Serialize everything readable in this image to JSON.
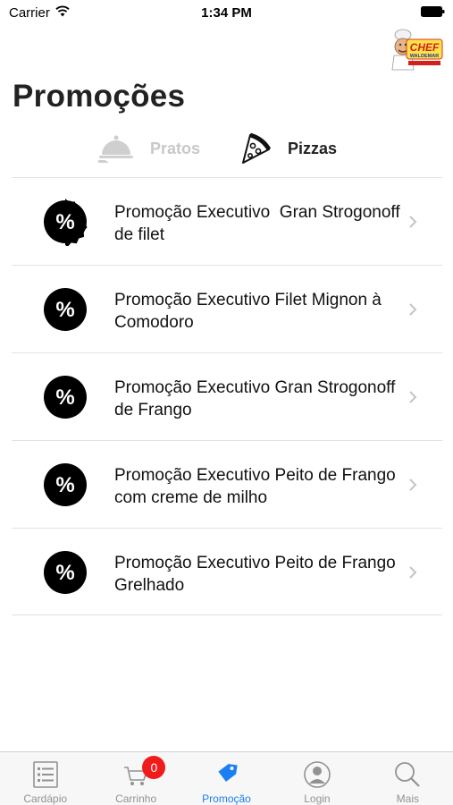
{
  "status_bar": {
    "carrier": "Carrier",
    "time": "1:34 PM"
  },
  "logo": {
    "text_top": "CHEF",
    "text_bottom": "WALDEMAR"
  },
  "page": {
    "title": "Promoções"
  },
  "tabs": [
    {
      "label": "Pratos",
      "icon": "cloche-icon",
      "active": false
    },
    {
      "label": "Pizzas",
      "icon": "pizza-slice-icon",
      "active": true
    }
  ],
  "promotions": [
    {
      "name": "Promoção Executivo  Gran Strogonoff de filet"
    },
    {
      "name": "Promoção Executivo Filet Mignon à Comodoro"
    },
    {
      "name": "Promoção Executivo Gran Strogonoff de Frango"
    },
    {
      "name": "Promoção Executivo Peito de Frango com creme de milho"
    },
    {
      "name": "Promoção Executivo Peito de Frango Grelhado"
    }
  ],
  "tab_bar": {
    "items": [
      {
        "label": "Cardápio",
        "icon": "menu-list-icon"
      },
      {
        "label": "Carrinho",
        "icon": "cart-icon",
        "badge": "0"
      },
      {
        "label": "Promoção",
        "icon": "tag-icon",
        "active": true
      },
      {
        "label": "Login",
        "icon": "user-icon"
      },
      {
        "label": "Mais",
        "icon": "search-icon"
      }
    ]
  },
  "colors": {
    "accent": "#1a7ff0",
    "badge": "#f01b1b",
    "inactive": "#929292"
  }
}
